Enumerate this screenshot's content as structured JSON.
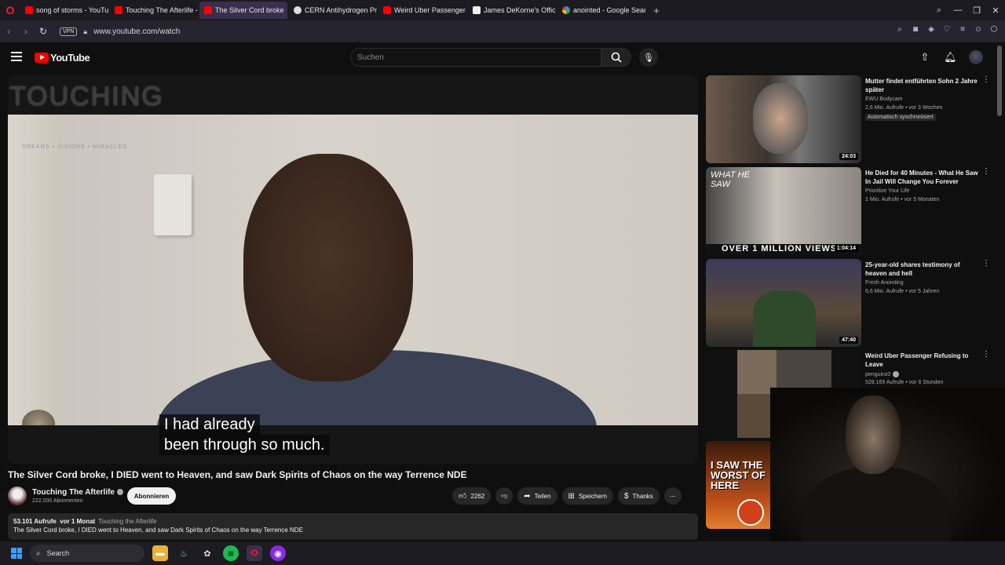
{
  "browser": {
    "tabs": [
      {
        "label": "song of storms - YouTube",
        "icon": "youtube-icon"
      },
      {
        "label": "Touching The Afterlife - Yo",
        "icon": "youtube-icon"
      },
      {
        "label": "The Silver Cord broke",
        "icon": "youtube-icon",
        "active": true
      },
      {
        "label": "CERN Antihydrogen Proje",
        "icon": "cern-icon"
      },
      {
        "label": "Weird Uber Passenger Ref",
        "icon": "youtube-icon"
      },
      {
        "label": "James DeKorne's Official",
        "icon": "doc-icon"
      },
      {
        "label": "anointed - Google Search",
        "icon": "google-icon"
      }
    ],
    "vpn_label": "VPN",
    "url": "www.youtube.com/watch"
  },
  "youtube": {
    "logo_text": "YouTube",
    "search_placeholder": "Suchen"
  },
  "video": {
    "overlay_title": "TOUCHING",
    "overlay_sub": "DREAMS • VISIONS • MIRACLES",
    "caption_line1": "I had already",
    "caption_line2": "been through so much.",
    "title": "The Silver Cord broke, I DIED went to Heaven, and saw Dark Spirits of Chaos on the way Terrence NDE",
    "channel_name": "Touching The Afterlife",
    "subscribers": "222.000 Abonnenten",
    "subscribe_label": "Abonnieren",
    "likes": "2262",
    "share_label": "Teilen",
    "save_label": "Speichern",
    "thanks_label": "Thanks",
    "views": "53.101 Aufrufe",
    "age": "vor 1 Monat",
    "channel_tag": "Touching the Afterlife",
    "desc_line": "The Silver Cord broke, I DIED went to Heaven, and saw Dark Spirits of Chaos on the way Terrence NDE"
  },
  "recommendations": [
    {
      "title": "Mutter findet entführten Sohn 2 Jahre später",
      "channel": "EWU Bodycam",
      "meta": "2,6 Mio. Aufrufe • vor 3 Wochen",
      "badge": "Automatisch synchronisiert",
      "duration": "24:03"
    },
    {
      "title": "He Died for 40 Minutes - What He Saw In Jail Will Change You Forever",
      "channel": "Prioritize Your Life",
      "meta": "1 Mio. Aufrufe • vor 5 Monaten",
      "duration": "1:04:14",
      "thumb_text": "WHAT HE SAW",
      "thumb_banner": "OVER 1 MILLION VIEWS"
    },
    {
      "title": "25-year-old shares testimony of heaven and hell",
      "channel": "Fresh Anointing",
      "meta": "6,6 Mio. Aufrufe • vor 5 Jahren",
      "duration": "47:40"
    },
    {
      "title": "Weird Uber Passenger Refusing to Leave",
      "channel": "penguinz0",
      "meta": "528.165 Aufrufe • vor 6 Stunden"
    },
    {
      "thumb_text": "I SAW THE WORST OF HERE"
    }
  ],
  "taskbar": {
    "search_label": "Search"
  }
}
